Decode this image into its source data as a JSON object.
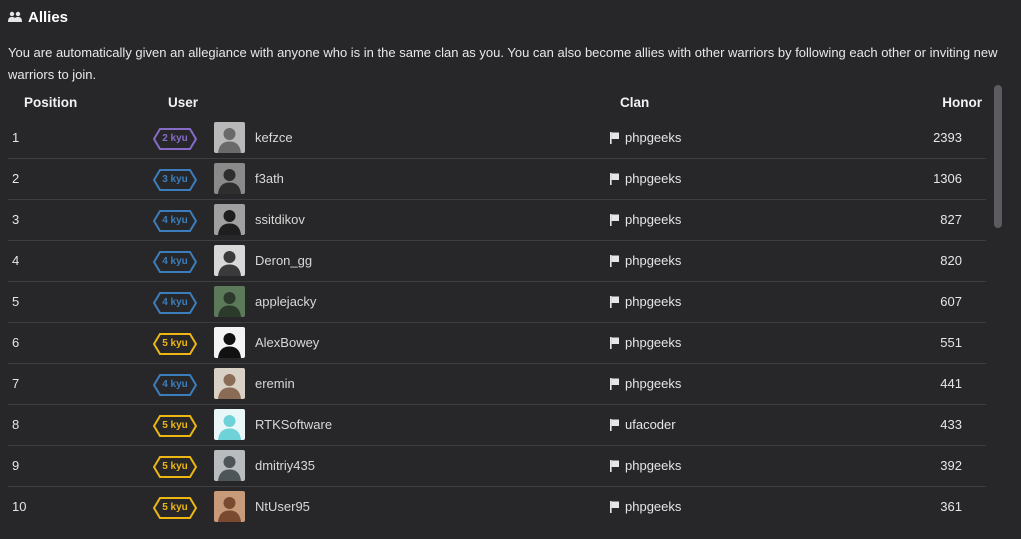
{
  "section": {
    "title": "Allies",
    "icon": "users-icon"
  },
  "description": "You are automatically given an allegiance with anyone who is in the same clan as you. You can also become allies with other warriors by following each other or inviting new warriors to join.",
  "table": {
    "headers": {
      "position": "Position",
      "user": "User",
      "clan": "Clan",
      "honor": "Honor"
    },
    "rows": [
      {
        "position": "1",
        "rank": "2 kyu",
        "username": "kefzce",
        "clan": "phpgeeks",
        "honor": "2393"
      },
      {
        "position": "2",
        "rank": "3 kyu",
        "username": "f3ath",
        "clan": "phpgeeks",
        "honor": "1306"
      },
      {
        "position": "3",
        "rank": "4 kyu",
        "username": "ssitdikov",
        "clan": "phpgeeks",
        "honor": "827"
      },
      {
        "position": "4",
        "rank": "4 kyu",
        "username": "Deron_gg",
        "clan": "phpgeeks",
        "honor": "820"
      },
      {
        "position": "5",
        "rank": "4 kyu",
        "username": "applejacky",
        "clan": "phpgeeks",
        "honor": "607"
      },
      {
        "position": "6",
        "rank": "5 kyu",
        "username": "AlexBowey",
        "clan": "phpgeeks",
        "honor": "551"
      },
      {
        "position": "7",
        "rank": "4 kyu",
        "username": "eremin",
        "clan": "phpgeeks",
        "honor": "441"
      },
      {
        "position": "8",
        "rank": "5 kyu",
        "username": "RTKSoftware",
        "clan": "ufacoder",
        "honor": "433"
      },
      {
        "position": "9",
        "rank": "5 kyu",
        "username": "dmitriy435",
        "clan": "phpgeeks",
        "honor": "392"
      },
      {
        "position": "10",
        "rank": "5 kyu",
        "username": "NtUser95",
        "clan": "phpgeeks",
        "honor": "361"
      }
    ]
  },
  "colors": {
    "background": "#27272a",
    "rank_purple": "#866cc7",
    "rank_blue": "#3c7ebb",
    "rank_yellow": "#ecb613"
  }
}
